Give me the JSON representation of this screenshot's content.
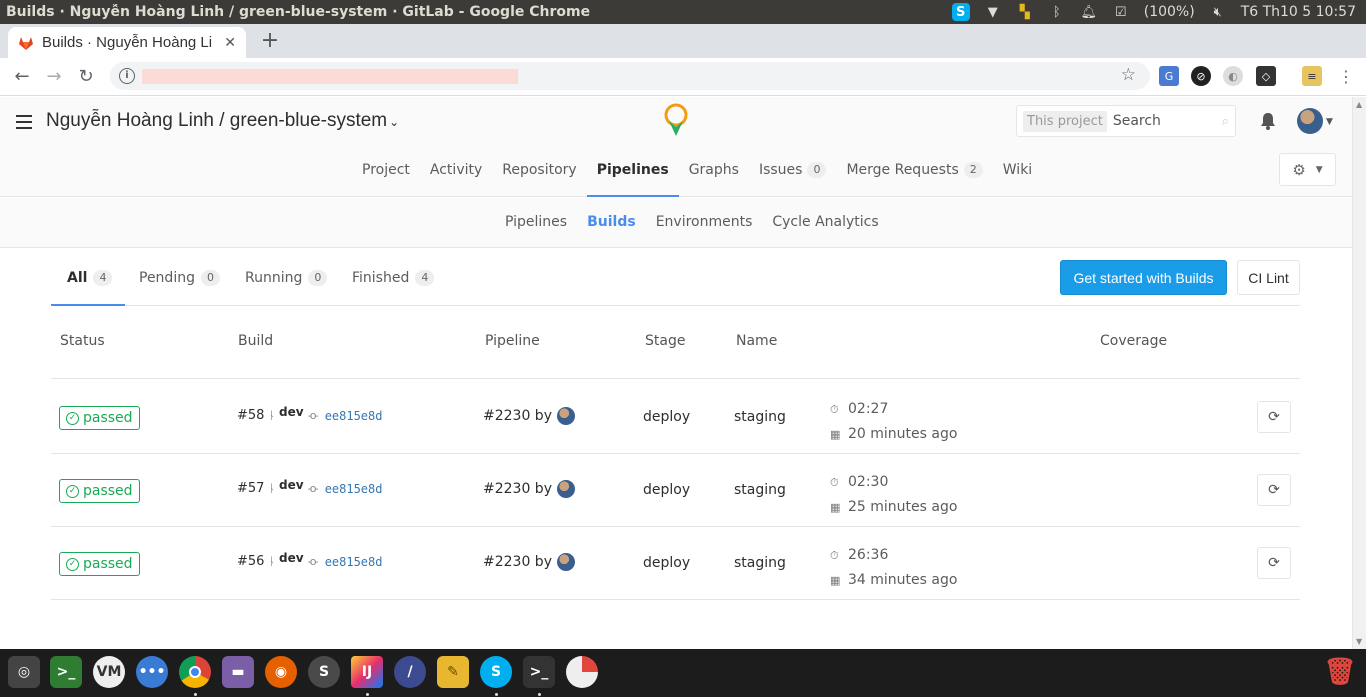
{
  "os": {
    "window_title": "Builds · Nguyễn Hoàng Linh / green-blue-system · GitLab - Google Chrome",
    "battery": "(100%)",
    "clock": "T6 Th10  5 10:57"
  },
  "browser": {
    "tab_title": "Builds · Nguyễn Hoàng Li",
    "close_glyph": "✕",
    "new_tab_glyph": "+",
    "back_glyph": "←",
    "forward_glyph": "→",
    "reload_glyph": "↻",
    "star_glyph": "☆"
  },
  "header": {
    "project_title": "Nguyễn Hoàng Linh / green-blue-system",
    "search_scope": "This project",
    "search_placeholder": "Search"
  },
  "main_nav": [
    {
      "label": "Project"
    },
    {
      "label": "Activity"
    },
    {
      "label": "Repository"
    },
    {
      "label": "Pipelines",
      "active": true
    },
    {
      "label": "Graphs"
    },
    {
      "label": "Issues",
      "badge": "0"
    },
    {
      "label": "Merge Requests",
      "badge": "2"
    },
    {
      "label": "Wiki"
    }
  ],
  "sub_nav": [
    {
      "label": "Pipelines"
    },
    {
      "label": "Builds",
      "active": true
    },
    {
      "label": "Environments"
    },
    {
      "label": "Cycle Analytics"
    }
  ],
  "scope_tabs": [
    {
      "label": "All",
      "count": "4",
      "active": true
    },
    {
      "label": "Pending",
      "count": "0"
    },
    {
      "label": "Running",
      "count": "0"
    },
    {
      "label": "Finished",
      "count": "4"
    }
  ],
  "actions": {
    "get_started": "Get started with Builds",
    "ci_lint": "CI Lint"
  },
  "table": {
    "columns": [
      "Status",
      "Build",
      "Pipeline",
      "Stage",
      "Name",
      "Coverage"
    ],
    "rows": [
      {
        "status": "passed",
        "build": "#58",
        "ref": "dev",
        "sha": "ee815e8d",
        "pipeline": "#2230 by",
        "stage": "deploy",
        "name": "staging",
        "duration": "02:27",
        "finished": "20 minutes ago"
      },
      {
        "status": "passed",
        "build": "#57",
        "ref": "dev",
        "sha": "ee815e8d",
        "pipeline": "#2230 by",
        "stage": "deploy",
        "name": "staging",
        "duration": "02:30",
        "finished": "25 minutes ago"
      },
      {
        "status": "passed",
        "build": "#56",
        "ref": "dev",
        "sha": "ee815e8d",
        "pipeline": "#2230 by",
        "stage": "deploy",
        "name": "staging",
        "duration": "26:36",
        "finished": "34 minutes ago"
      }
    ]
  },
  "colors": {
    "accent": "#4a8bee",
    "success": "#1aaa55",
    "primary_button": "#1a9ce8"
  },
  "dock_icons": [
    "ubuntu-dash",
    "terminal-green",
    "vim",
    "more-apps",
    "chrome",
    "files",
    "firefox",
    "sublime-text",
    "intellij",
    "pen-tool",
    "gimp",
    "skype",
    "terminal",
    "disk-usage",
    "trash"
  ]
}
